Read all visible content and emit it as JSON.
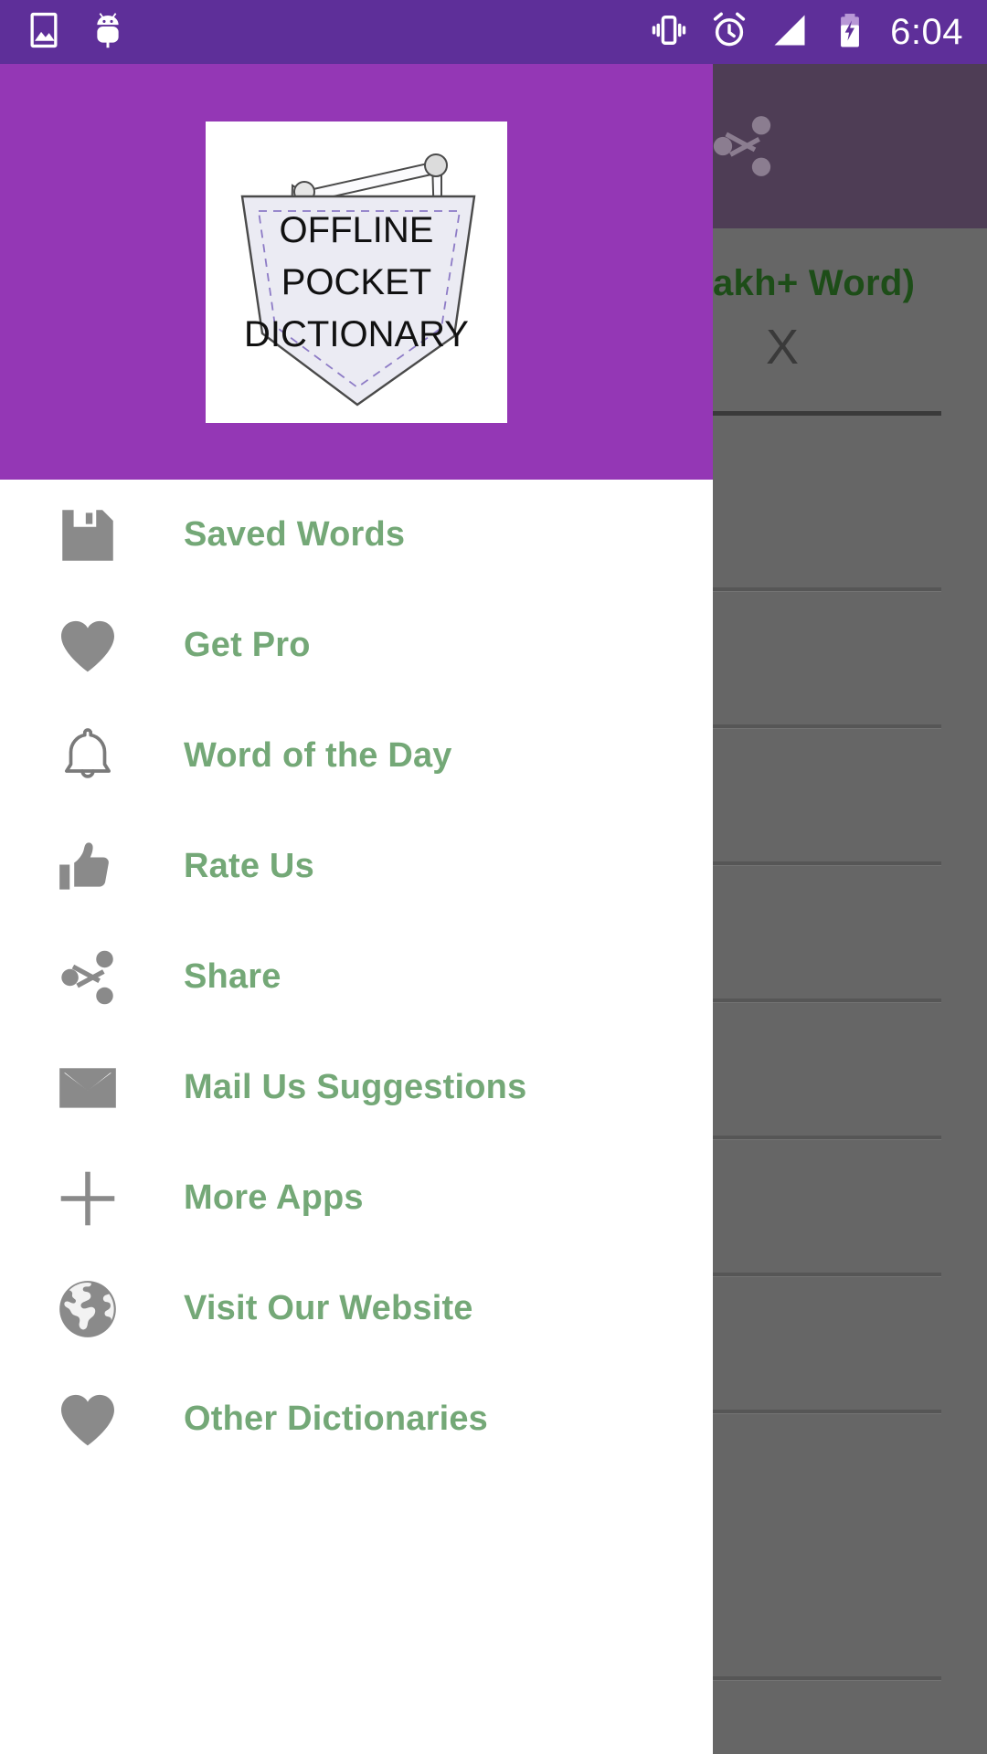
{
  "status_bar": {
    "time": "6:04",
    "background_color": "#5e2f99",
    "left_icons": [
      {
        "name": "image-icon",
        "glyph": "picture"
      },
      {
        "name": "android-debug-icon",
        "glyph": "android-bug"
      }
    ],
    "right_icons": [
      {
        "name": "vibrate-icon",
        "glyph": "vibration"
      },
      {
        "name": "alarm-icon",
        "glyph": "alarm-clock"
      },
      {
        "name": "signal-icon",
        "glyph": "cell-signal"
      },
      {
        "name": "battery-charging-icon",
        "glyph": "battery-charging"
      }
    ]
  },
  "drawer": {
    "header": {
      "background_color": "#9437b5",
      "logo": {
        "name": "app-logo",
        "line1": "OFFLINE",
        "line2": "POCKET",
        "line3": "DICTIONARY"
      }
    },
    "label_color": "#74a877",
    "icon_color": "#8a8a8a",
    "items": [
      {
        "label": "Saved Words",
        "icon": "save-icon"
      },
      {
        "label": "Get Pro",
        "icon": "heart-icon"
      },
      {
        "label": "Word of the Day",
        "icon": "bell-outline-icon"
      },
      {
        "label": "Rate Us",
        "icon": "thumbs-up-icon"
      },
      {
        "label": "Share",
        "icon": "share-icon"
      },
      {
        "label": "Mail Us Suggestions",
        "icon": "mail-icon"
      },
      {
        "label": "More Apps",
        "icon": "plus-icon"
      },
      {
        "label": "Visit Our Website",
        "icon": "globe-icon"
      },
      {
        "label": "Other Dictionaries",
        "icon": "heart-icon"
      }
    ]
  },
  "background_app": {
    "scrim_color": "#666666",
    "toolbar": {
      "background_color": "#4e3d55",
      "icons": [
        {
          "name": "notification-bell-icon"
        },
        {
          "name": "share-icon"
        }
      ]
    },
    "title_fragment": "akh+ Word)",
    "title_color": "#1d4d18",
    "clear_button": "X",
    "list_divider_count": 8
  }
}
